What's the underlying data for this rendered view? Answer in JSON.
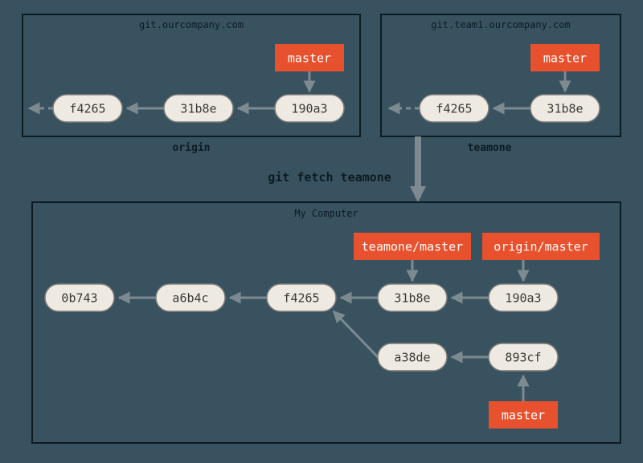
{
  "origin": {
    "host": "git.ourcompany.com",
    "label": "origin",
    "ref": "master",
    "commits": [
      "f4265",
      "31b8e",
      "190a3"
    ]
  },
  "teamone": {
    "host": "git.team1.ourcompany.com",
    "label": "teamone",
    "ref": "master",
    "commits": [
      "f4265",
      "31b8e"
    ]
  },
  "fetch_command": "git fetch teamone",
  "local": {
    "title": "My Computer",
    "remote_refs": {
      "teamone": "teamone/master",
      "origin": "origin/master"
    },
    "local_ref": "master",
    "main_line": [
      "0b743",
      "a6b4c",
      "f4265",
      "31b8e",
      "190a3"
    ],
    "branch_line": [
      "a38de",
      "893cf"
    ]
  }
}
